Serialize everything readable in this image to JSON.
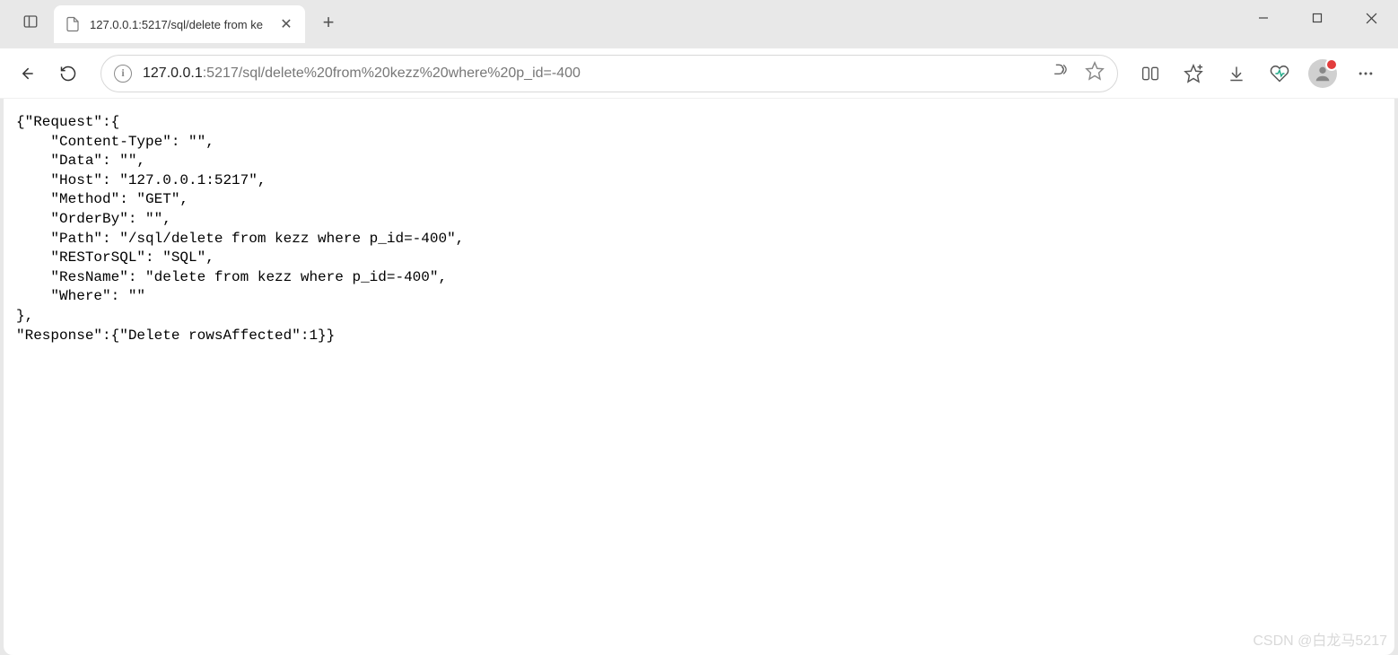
{
  "window": {
    "tab_title": "127.0.0.1:5217/sql/delete from ke"
  },
  "address": {
    "host": "127.0.0.1",
    "rest": ":5217/sql/delete%20from%20kezz%20where%20p_id=-400"
  },
  "page": {
    "body": "{\"Request\":{\n    \"Content-Type\": \"\",\n    \"Data\": \"\",\n    \"Host\": \"127.0.0.1:5217\",\n    \"Method\": \"GET\",\n    \"OrderBy\": \"\",\n    \"Path\": \"/sql/delete from kezz where p_id=-400\",\n    \"RESTorSQL\": \"SQL\",\n    \"ResName\": \"delete from kezz where p_id=-400\",\n    \"Where\": \"\"\n},\n\"Response\":{\"Delete rowsAffected\":1}}"
  },
  "watermark": "CSDN @白龙马5217"
}
